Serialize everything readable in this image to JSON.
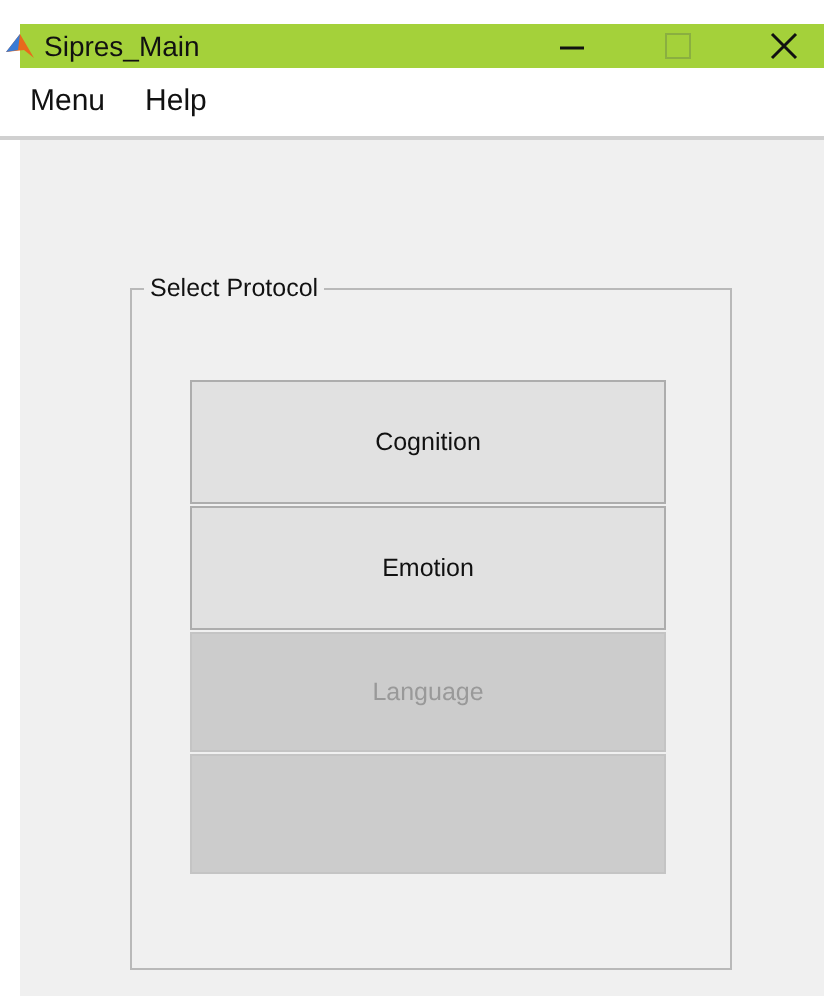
{
  "window": {
    "title": "Sipres_Main"
  },
  "menu": [
    {
      "label": "Menu"
    },
    {
      "label": "Help"
    }
  ],
  "panel": {
    "title": "Select Protocol",
    "buttons": [
      {
        "label": "Cognition",
        "disabled": false
      },
      {
        "label": "Emotion",
        "disabled": false
      },
      {
        "label": "Language",
        "disabled": true
      },
      {
        "disabled": true
      }
    ]
  }
}
